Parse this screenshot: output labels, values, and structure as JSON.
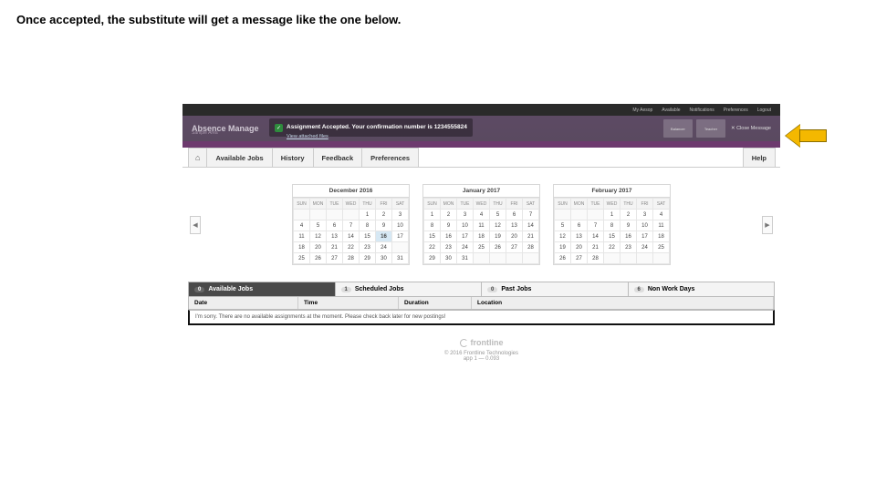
{
  "caption": "Once accepted, the substitute will get a message like the one below.",
  "topbar": {
    "items": [
      "My Aesop",
      "Available",
      "Notifications",
      "Preferences",
      "Logout"
    ]
  },
  "banner": {
    "title": "Absence Manage",
    "subtitle": "Sample Area",
    "confirm_bold": "Assignment Accepted. Your confirmation number is ",
    "confirm_num": "1234555824",
    "confirm_link": "View attached files",
    "cards": [
      "Balancer",
      "Teacher"
    ],
    "close": "✕ Close Message"
  },
  "nav": {
    "tabs": [
      "Available Jobs",
      "History",
      "Feedback",
      "Preferences"
    ],
    "help": "Help"
  },
  "calendars": [
    {
      "title": "December 2016",
      "dow": [
        "SUN",
        "MON",
        "TUE",
        "WED",
        "THU",
        "FRI",
        "SAT"
      ],
      "weeks": [
        [
          "",
          "",
          "",
          "",
          "1",
          "2",
          "3"
        ],
        [
          "4",
          "5",
          "6",
          "7",
          "8",
          "9",
          "10"
        ],
        [
          "11",
          "12",
          "13",
          "14",
          "15",
          "16",
          "17"
        ],
        [
          "18",
          "20",
          "21",
          "22",
          "23",
          "24",
          ""
        ],
        [
          "25",
          "26",
          "27",
          "28",
          "29",
          "30",
          "31"
        ]
      ],
      "today": "16"
    },
    {
      "title": "January 2017",
      "dow": [
        "SUN",
        "MON",
        "TUE",
        "WED",
        "THU",
        "FRI",
        "SAT"
      ],
      "weeks": [
        [
          "1",
          "2",
          "3",
          "4",
          "5",
          "6",
          "7"
        ],
        [
          "8",
          "9",
          "10",
          "11",
          "12",
          "13",
          "14"
        ],
        [
          "15",
          "16",
          "17",
          "18",
          "19",
          "20",
          "21"
        ],
        [
          "22",
          "23",
          "24",
          "25",
          "26",
          "27",
          "28"
        ],
        [
          "29",
          "30",
          "31",
          "",
          "",
          "",
          ""
        ]
      ]
    },
    {
      "title": "February 2017",
      "dow": [
        "SUN",
        "MON",
        "TUE",
        "WED",
        "THU",
        "FRI",
        "SAT"
      ],
      "weeks": [
        [
          "",
          "",
          "",
          "1",
          "2",
          "3",
          "4"
        ],
        [
          "5",
          "6",
          "7",
          "8",
          "9",
          "10",
          "11"
        ],
        [
          "12",
          "13",
          "14",
          "15",
          "16",
          "17",
          "18"
        ],
        [
          "19",
          "20",
          "21",
          "22",
          "23",
          "24",
          "25"
        ],
        [
          "26",
          "27",
          "28",
          "",
          "",
          "",
          ""
        ]
      ]
    }
  ],
  "jobTabs": [
    {
      "count": "0",
      "label": "Available Jobs",
      "active": true
    },
    {
      "count": "1",
      "label": "Scheduled Jobs"
    },
    {
      "count": "0",
      "label": "Past Jobs"
    },
    {
      "count": "6",
      "label": "Non Work Days"
    }
  ],
  "table": {
    "cols": [
      "Date",
      "Time",
      "Duration",
      "Location"
    ],
    "empty": "I'm sorry. There are no available assignments at the moment. Please check back later for new postings!"
  },
  "footer": {
    "brand": "frontline",
    "copyright": "© 2016 Frontline Technologies",
    "build": "app 1 — 0.093"
  }
}
